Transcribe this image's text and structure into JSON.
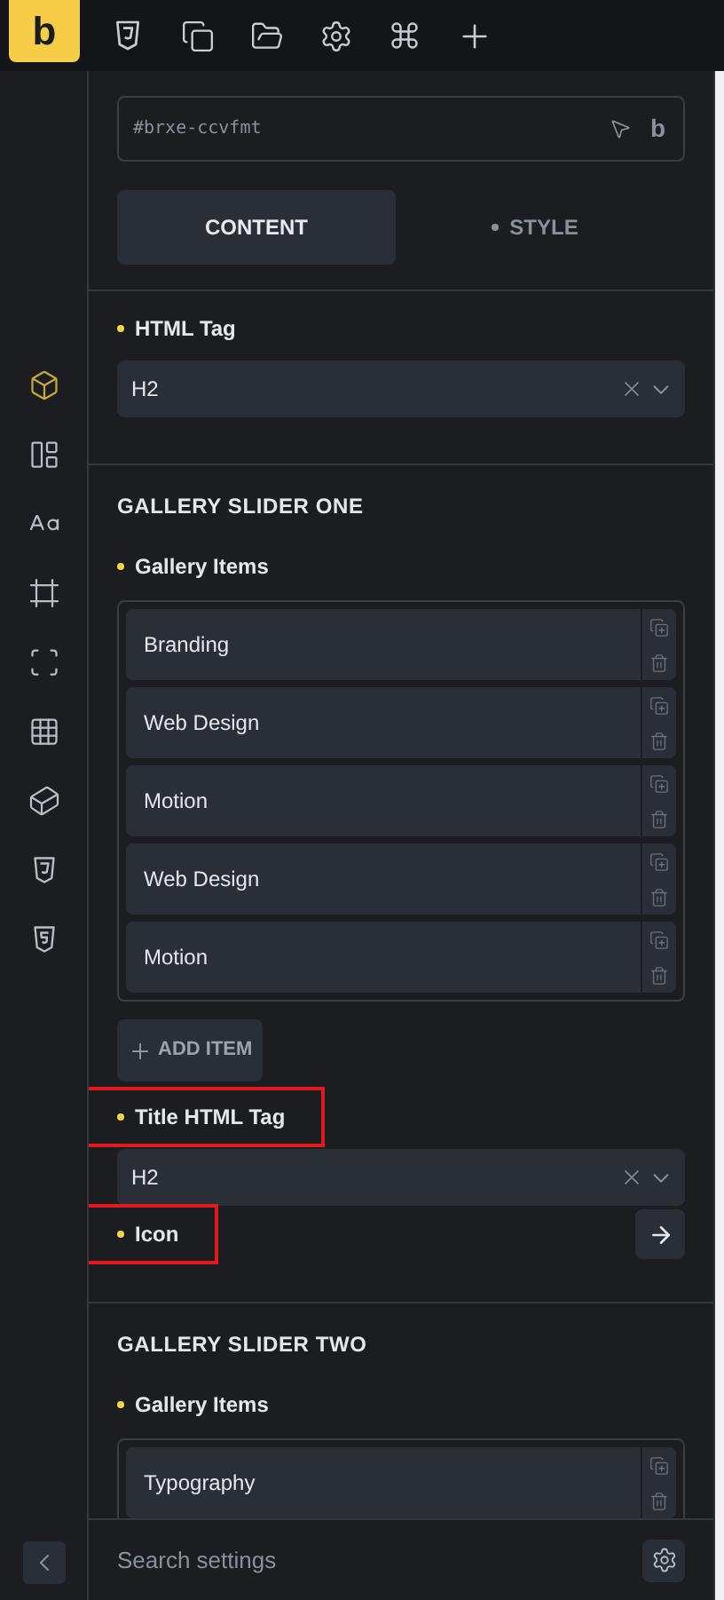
{
  "toolbar": {
    "logo": "b"
  },
  "element_id": {
    "value": "#brxe-ccvfmt",
    "badge": "b"
  },
  "tabs": [
    {
      "label": "CONTENT",
      "selected": true,
      "modified": false
    },
    {
      "label": "STYLE",
      "selected": false,
      "modified": true
    }
  ],
  "html_tag": {
    "label": "HTML Tag",
    "value": "H2"
  },
  "sections": [
    {
      "title": "GALLERY SLIDER ONE",
      "items_label": "Gallery Items",
      "items": [
        "Branding",
        "Web Design",
        "Motion",
        "Web Design",
        "Motion"
      ],
      "add_label": "ADD ITEM",
      "title_tag": {
        "label": "Title HTML Tag",
        "value": "H2",
        "highlighted": true
      },
      "icon": {
        "label": "Icon",
        "highlighted": true
      }
    },
    {
      "title": "GALLERY SLIDER TWO",
      "items_label": "Gallery Items",
      "items": [
        "Typography"
      ]
    }
  ],
  "search": {
    "placeholder": "Search settings"
  }
}
